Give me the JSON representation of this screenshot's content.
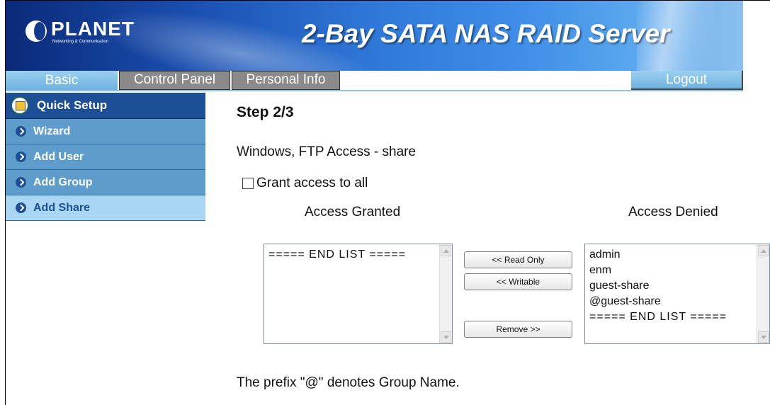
{
  "banner": {
    "logo_text": "PLANET",
    "logo_tagline": "Networking & Communication",
    "product_title": "2-Bay SATA NAS RAID Server"
  },
  "nav": {
    "tabs": [
      {
        "label": "Basic"
      },
      {
        "label": "Control Panel"
      },
      {
        "label": "Personal Info"
      }
    ],
    "logout_label": "Logout"
  },
  "sidebar": {
    "header": "Quick Setup",
    "items": [
      {
        "label": "Wizard"
      },
      {
        "label": "Add User"
      },
      {
        "label": "Add Group"
      },
      {
        "label": "Add Share"
      }
    ]
  },
  "main": {
    "step": "Step 2/3",
    "subtitle": "Windows, FTP Access - share",
    "grant_all_label": "Grant access to all",
    "granted_header": "Access Granted",
    "denied_header": "Access Denied",
    "granted_list": [
      "===== END LIST ====="
    ],
    "denied_list": [
      "admin",
      "enm",
      "guest-share",
      "@guest-share",
      "===== END LIST ====="
    ],
    "buttons": {
      "read_only": "<< Read Only",
      "writable": "<< Writable",
      "remove": "Remove >>"
    },
    "footnote": "The prefix \"@\" denotes Group Name."
  },
  "colors": {
    "banner_dark": "#0a2a78",
    "sidebar_header": "#1d4f96",
    "sidebar_item": "#5e9ccc",
    "sidebar_active": "#a9d6f2",
    "tab_gray": "#8a8a8a"
  }
}
